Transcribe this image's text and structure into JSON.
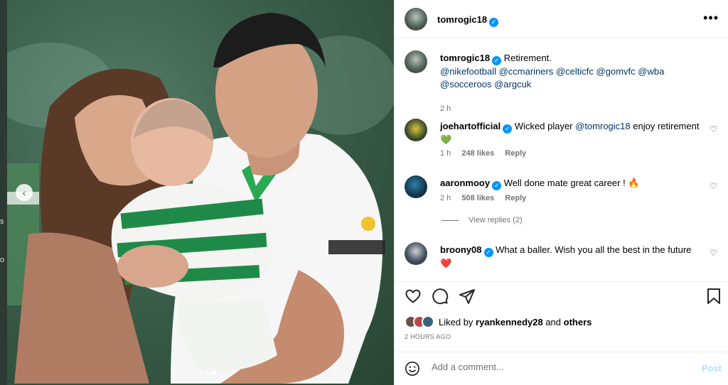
{
  "edge": {
    "char1": "s",
    "char2": "o"
  },
  "post": {
    "author": "tomrogic18",
    "caption": {
      "username": "tomrogic18",
      "text": "Retirement.",
      "tags_line1": [
        "@nikefootball",
        "@ccmariners",
        "@celticfc",
        "@gomvfc",
        "@wba"
      ],
      "tags_line2": [
        "@socceroos",
        "@argcuk"
      ],
      "time": "2 h"
    }
  },
  "comments": [
    {
      "username": "joehartofficial",
      "text_before": "Wicked player ",
      "mention": "@tomrogic18",
      "text_after": " enjoy retirement",
      "emoji": "💚",
      "time": "1 h",
      "likes": "248 likes",
      "reply": "Reply"
    },
    {
      "username": "aaronmooy",
      "text": "Well done mate great career ! 🔥",
      "time": "2 h",
      "likes": "508 likes",
      "reply": "Reply",
      "view_replies": "View replies (2)"
    },
    {
      "username": "broony08",
      "text": "What a baller. Wish you all the best in the future",
      "emoji": "❤️"
    }
  ],
  "liked_by": {
    "prefix": "Liked by ",
    "user": "ryankennedy28",
    "mid": " and ",
    "others": "others"
  },
  "timestamp": "2 HOURS AGO",
  "comment_input": {
    "placeholder": "Add a comment...",
    "post_label": "Post"
  },
  "colors": {
    "verified": "#0095f6",
    "mention": "#00376b",
    "post_disabled": "#b2dffc",
    "celtic_green": "#1f8a47"
  }
}
